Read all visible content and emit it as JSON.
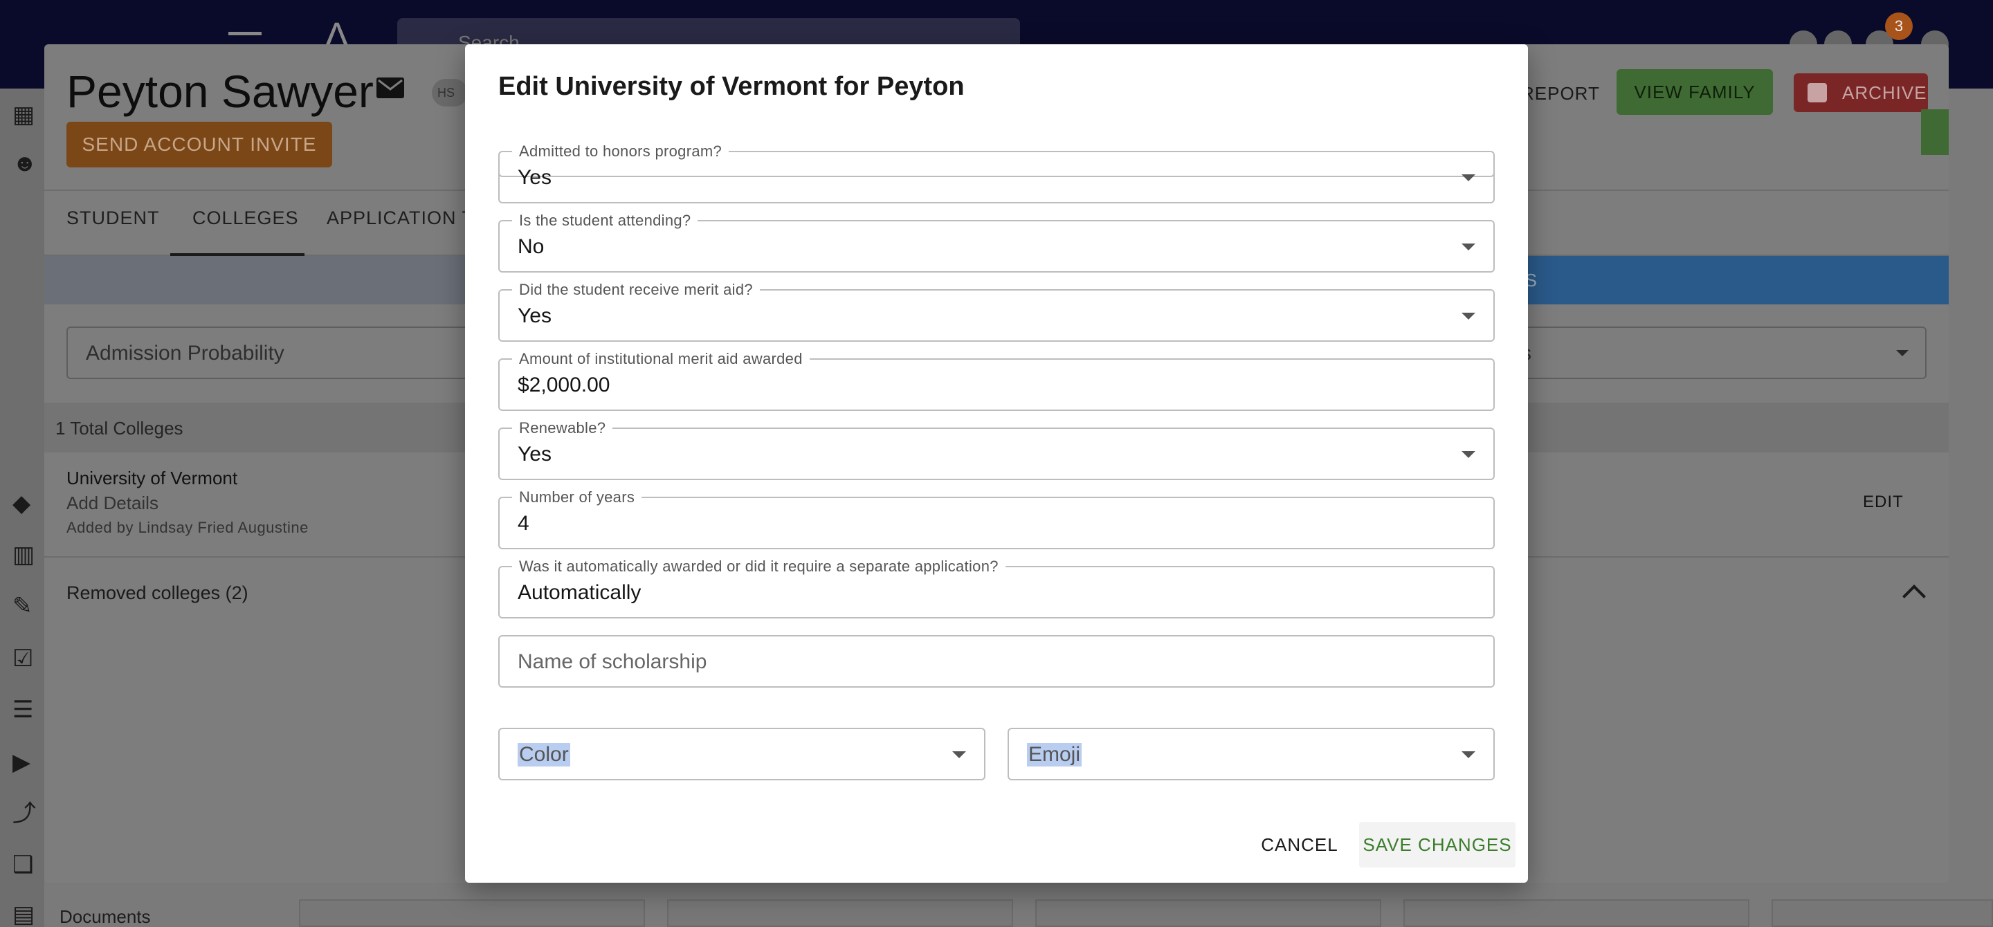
{
  "topbar": {
    "search_placeholder": "Search",
    "notification_count": "3"
  },
  "student": {
    "name": "Peyton Sawyer",
    "grade_badge": "HS",
    "invite_label": "SEND ACCOUNT INVITE",
    "report_label": "REPORT",
    "view_family_label": "VIEW FAMILY",
    "archive_label": "ARCHIVE"
  },
  "tabs": [
    {
      "label": "STUDENT"
    },
    {
      "label": "COLLEGES"
    },
    {
      "label": "APPLICATION TR"
    }
  ],
  "colleges_view": {
    "blue_tab_fragment": "GES",
    "admission_filter": "Admission Probability",
    "emoji_filter": "ojis",
    "total_label": "1 Total Colleges",
    "college": {
      "name": "University of Vermont",
      "details": "Add Details",
      "added_by": "Added by Lindsay Fried Augustine",
      "edit_label": "EDIT"
    },
    "removed_label": "Removed colleges (2)"
  },
  "sidebar": {
    "documents_label": "Documents"
  },
  "dialog": {
    "title": "Edit University of Vermont for Peyton",
    "fields": {
      "honors": {
        "label": "Admitted to honors program?",
        "value": "Yes"
      },
      "attending": {
        "label": "Is the student attending?",
        "value": "No"
      },
      "merit": {
        "label": "Did the student receive merit aid?",
        "value": "Yes"
      },
      "amount": {
        "label": "Amount of institutional merit aid awarded",
        "value": "$2,000.00"
      },
      "renewable": {
        "label": "Renewable?",
        "value": "Yes"
      },
      "years": {
        "label": "Number of years",
        "value": "4"
      },
      "award_type": {
        "label": "Was it automatically awarded or did it require a separate application?",
        "value": "Automatically"
      },
      "scholarship": {
        "placeholder": "Name of scholarship"
      },
      "color": {
        "placeholder": "Color"
      },
      "emoji": {
        "placeholder": "Emoji"
      }
    },
    "cancel_label": "CANCEL",
    "save_label": "SAVE CHANGES"
  }
}
